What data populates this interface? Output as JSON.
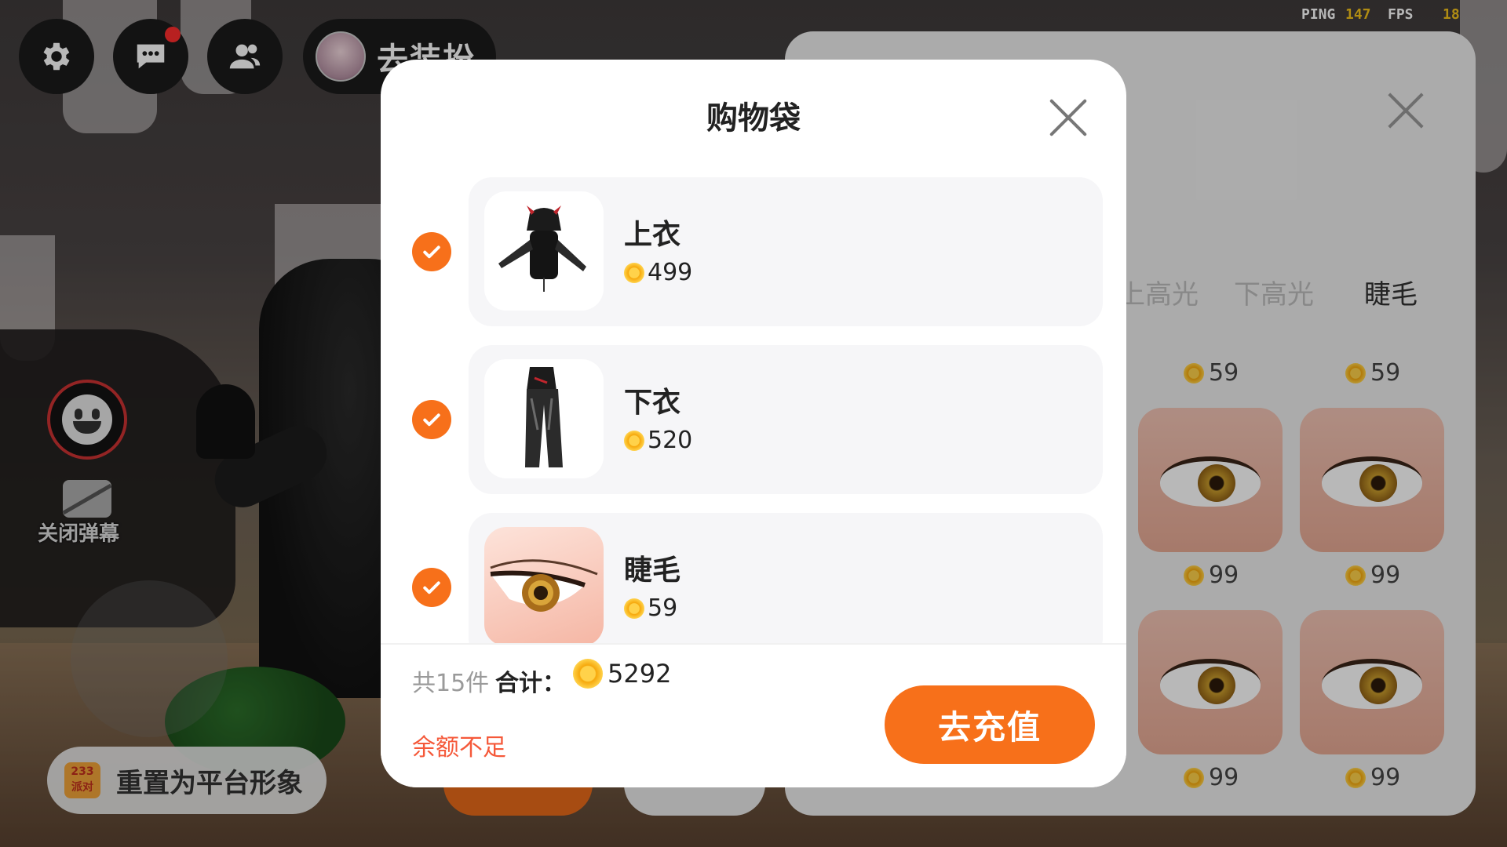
{
  "hud": {
    "settings_icon": "gear-icon",
    "chat_icon": "chat-bubble-icon",
    "friends_icon": "friends-icon",
    "dress_up_label": "去装扮",
    "ping_label": "PING",
    "ping_value": "147",
    "fps_label": "FPS",
    "fps_value": "18",
    "close_danmu_label": "关闭弹幕",
    "reset_badge": "233派对",
    "reset_label": "重置为平台形象"
  },
  "background_panel": {
    "tabs": [
      {
        "label": "上高光"
      },
      {
        "label": "下高光"
      },
      {
        "label": "睫毛",
        "active": true
      }
    ],
    "prices": [
      "59",
      "59",
      "99",
      "99",
      "99",
      "99"
    ]
  },
  "modal": {
    "title": "购物袋",
    "items": [
      {
        "name": "上衣",
        "price": "499",
        "checked": true
      },
      {
        "name": "下衣",
        "price": "520",
        "checked": true
      },
      {
        "name": "睫毛",
        "price": "59",
        "checked": true
      }
    ],
    "count_text": "共15件",
    "total_label": "合计：",
    "total_value": "5292",
    "insufficient_text": "余额不足",
    "recharge_label": "去充值"
  },
  "colors": {
    "accent": "#f7701a",
    "warning_text": "#f5593a",
    "coin": "#ffc21a"
  }
}
